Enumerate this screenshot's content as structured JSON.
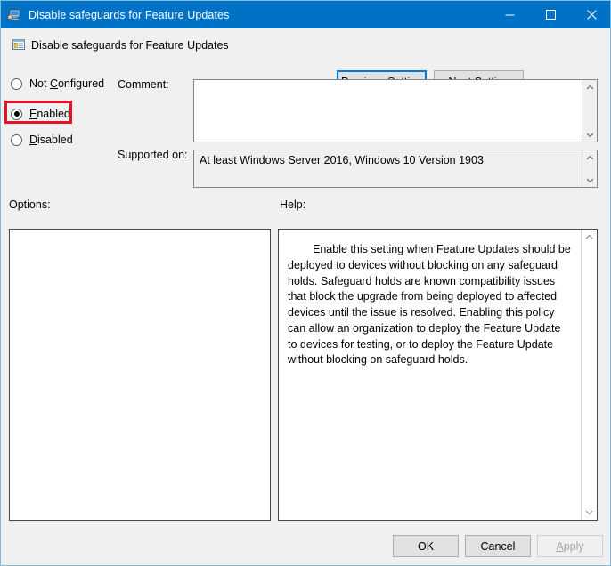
{
  "window": {
    "title": "Disable safeguards for Feature Updates",
    "title_icon": "policy-computer-icon",
    "minimize_icon": "minimize-icon",
    "maximize_icon": "maximize-icon",
    "close_icon": "close-icon",
    "titlebar_color": "#0072c6",
    "dialog_background": "#f0f0f0",
    "border_color": "#7ebbdc"
  },
  "header": {
    "icon": "policy-setting-icon",
    "title": "Disable safeguards for Feature Updates",
    "previous_setting_label": "Previous Setting",
    "previous_setting_accel": "P",
    "next_setting_label": "Next Setting",
    "next_setting_accel": "N",
    "focused_button": "Previous Setting"
  },
  "state_options": {
    "selected": "Enabled",
    "items": [
      {
        "label": "Not Configured",
        "accel": "C",
        "checked": false
      },
      {
        "label": "Enabled",
        "accel": "E",
        "checked": true
      },
      {
        "label": "Disabled",
        "accel": "D",
        "checked": false
      }
    ]
  },
  "annotation": {
    "target": "Enabled",
    "color": "#e81123"
  },
  "comment": {
    "label": "Comment:",
    "value": "",
    "placeholder": ""
  },
  "supported_on": {
    "label": "Supported on:",
    "value": "At least Windows Server 2016, Windows 10 Version 1903"
  },
  "options": {
    "label": "Options:",
    "content": ""
  },
  "help": {
    "label": "Help:",
    "text": "Enable this setting when Feature Updates should be deployed to devices without blocking on any safeguard holds. Safeguard holds are known compatibility issues that block the upgrade from being deployed to affected devices until the issue is resolved. Enabling this policy can allow an organization to deploy the Feature Update to devices for testing, or to deploy the Feature Update without blocking on safeguard holds."
  },
  "footer": {
    "ok_label": "OK",
    "cancel_label": "Cancel",
    "apply_label": "Apply",
    "apply_accel": "A",
    "apply_disabled": true
  },
  "scrollbar": {
    "up_arrow": "chevron-up-icon",
    "down_arrow": "chevron-down-icon"
  }
}
